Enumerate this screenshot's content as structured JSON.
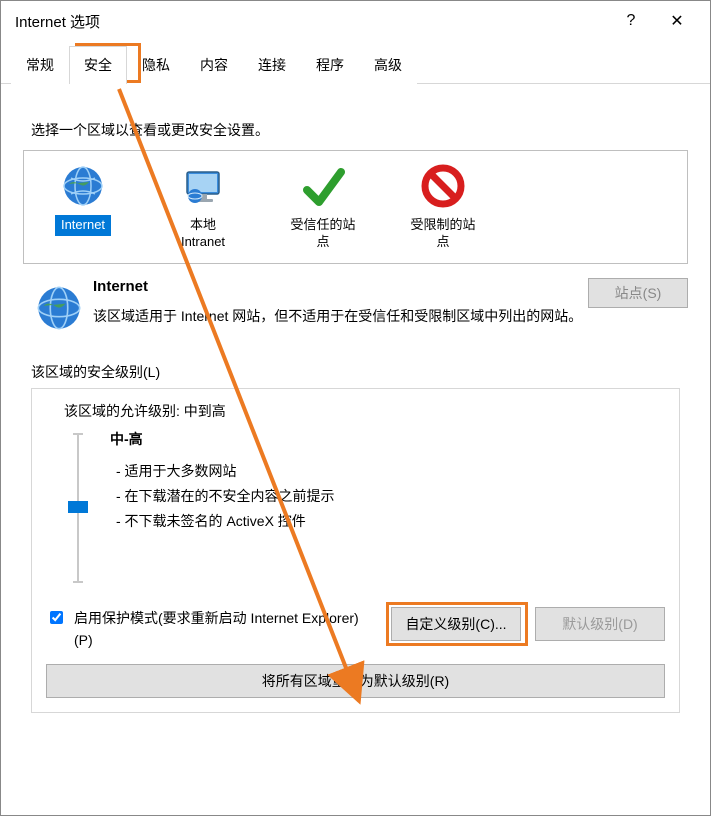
{
  "window": {
    "title": "Internet 选项",
    "help_glyph": "?",
    "close_glyph": "✕"
  },
  "tabs": [
    "常规",
    "安全",
    "隐私",
    "内容",
    "连接",
    "程序",
    "高级"
  ],
  "active_tab_index": 1,
  "instruction": "选择一个区域以查看或更改安全设置。",
  "zones": [
    {
      "label": "Internet",
      "selected": true,
      "icon": "globe"
    },
    {
      "label": "本地\nIntranet",
      "selected": false,
      "icon": "monitor"
    },
    {
      "label": "受信任的站\n点",
      "selected": false,
      "icon": "check"
    },
    {
      "label": "受限制的站\n点",
      "selected": false,
      "icon": "no"
    }
  ],
  "detail": {
    "name": "Internet",
    "text": "该区域适用于 Internet 网站，但不适用于在受信任和受限制区域中列出的网站。",
    "sites_button": "站点(S)"
  },
  "security": {
    "group_title": "该区域的安全级别(L)",
    "allowed": "该区域的允许级别: 中到高",
    "level_name": "中-高",
    "level_desc": [
      "- 适用于大多数网站",
      "- 在下载潜在的不安全内容之前提示",
      "- 不下载未签名的 ActiveX 控件"
    ],
    "protect_label": "启用保护模式(要求重新启动 Internet Explorer)(P)",
    "custom_button": "自定义级别(C)...",
    "default_button": "默认级别(D)",
    "reset_button": "将所有区域重置为默认级别(R)"
  }
}
